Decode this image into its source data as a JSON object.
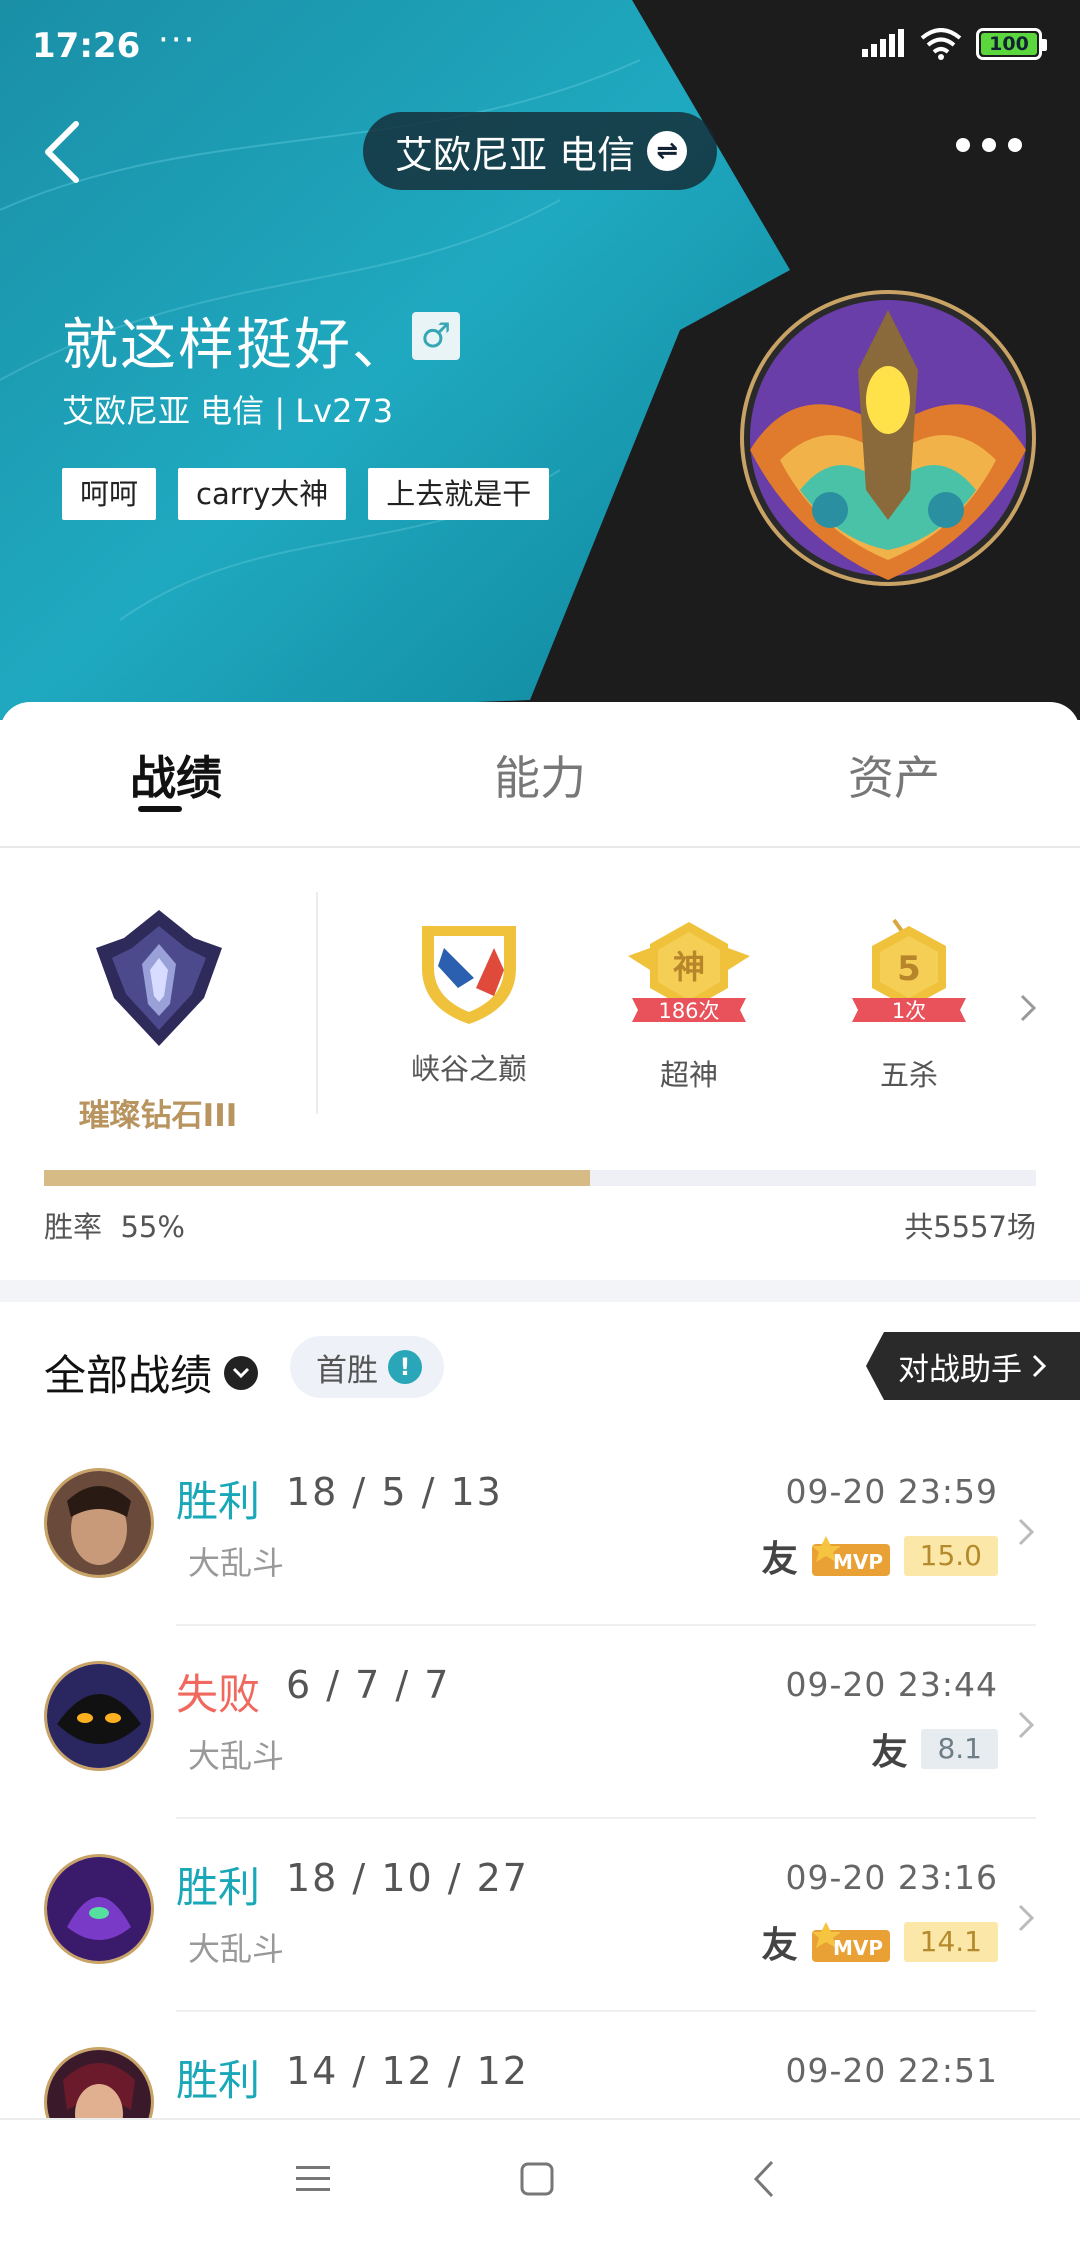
{
  "status_bar": {
    "time": "17:26",
    "notif_dots": "···",
    "battery": "100"
  },
  "header": {
    "server": "艾欧尼亚 电信",
    "swap_icon": "swap-icon",
    "more_icon": "more-icon",
    "back_icon": "back-arrow-icon"
  },
  "profile": {
    "name": "就这样挺好、",
    "gender_symbol": "♂",
    "subtitle": "艾欧尼亚 电信 | Lv273",
    "tags": [
      "呵呵",
      "carry大神",
      "上去就是干"
    ]
  },
  "tabs": [
    "战绩",
    "能力",
    "资产"
  ],
  "rank": {
    "label": "璀璨钻石III"
  },
  "honors": [
    {
      "label": "峡谷之巅",
      "badge": ""
    },
    {
      "label": "超神",
      "badge": "186次",
      "icon_text": "神"
    },
    {
      "label": "五杀",
      "badge": "1次",
      "icon_text": "5"
    }
  ],
  "stats": {
    "winrate_label": "胜率",
    "winrate": "55%",
    "winrate_value": 0.55,
    "total": "共5557场"
  },
  "filter": {
    "label": "全部战绩",
    "first_win": "首胜",
    "first_win_icon": "!",
    "assistant": "对战助手"
  },
  "matches": [
    {
      "result": "胜利",
      "kda": "18 / 5 / 13",
      "mode": "大乱斗",
      "time": "09-20 23:59",
      "friend": "友",
      "mvp": true,
      "score": "15.0"
    },
    {
      "result": "失败",
      "kda": "6 / 7 / 7",
      "mode": "大乱斗",
      "time": "09-20 23:44",
      "friend": "友",
      "mvp": false,
      "score": "8.1"
    },
    {
      "result": "胜利",
      "kda": "18 / 10 / 27",
      "mode": "大乱斗",
      "time": "09-20 23:16",
      "friend": "友",
      "mvp": true,
      "score": "14.1"
    },
    {
      "result": "胜利",
      "kda": "14 / 12 / 12",
      "mode": "",
      "time": "09-20 22:51",
      "friend": "",
      "mvp": false,
      "score": ""
    }
  ],
  "mvp_label": "MVP",
  "colors": {
    "accent": "#1aa7b8",
    "win": "#1aa7b8",
    "lose": "#f0685e",
    "gold": "#d6bb87"
  }
}
